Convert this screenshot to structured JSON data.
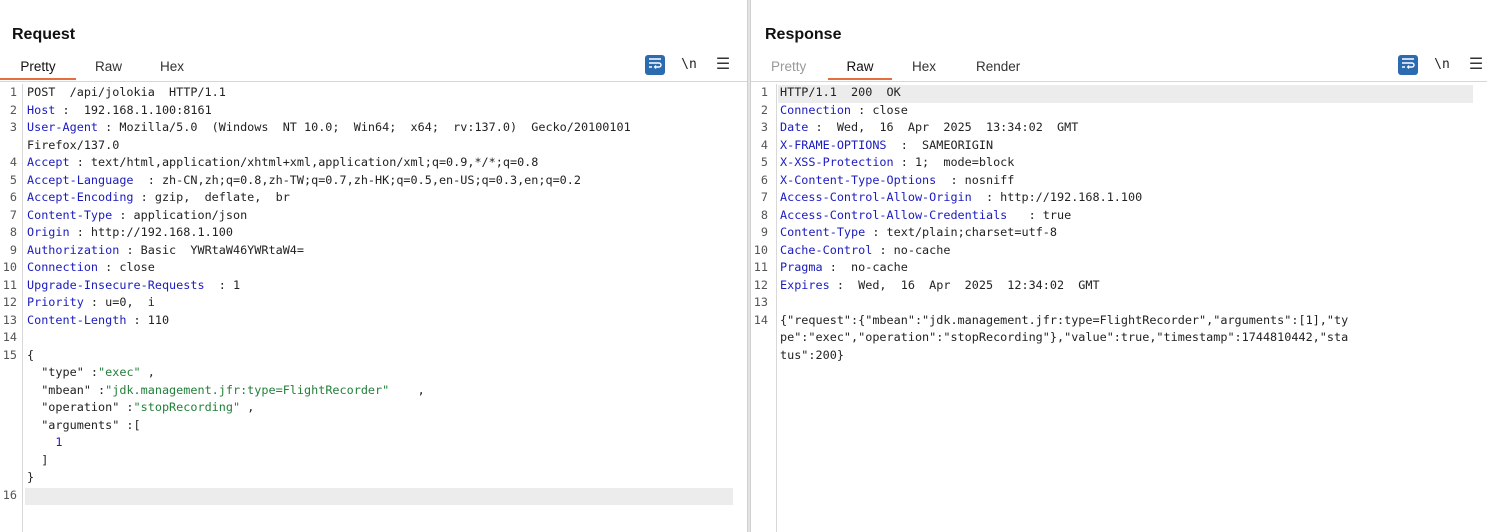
{
  "request": {
    "title": "Request",
    "tabs": [
      "Pretty",
      "Raw",
      "Hex"
    ],
    "active_tab": "Pretty",
    "lines": [
      {
        "n": "1",
        "parts": [
          [
            "",
            "POST  /api/jolokia  HTTP/1.1"
          ]
        ]
      },
      {
        "n": "2",
        "parts": [
          [
            "hdr",
            "Host"
          ],
          [
            "",
            " :  192.168.1.100:8161"
          ]
        ]
      },
      {
        "n": "3",
        "parts": [
          [
            "hdr",
            "User-Agent"
          ],
          [
            "",
            " : Mozilla/5.0  (Windows  NT 10.0;  Win64;  x64;  rv:137.0)  Gecko/20100101"
          ]
        ]
      },
      {
        "n": "",
        "parts": [
          [
            "",
            "Firefox/137.0"
          ]
        ]
      },
      {
        "n": "4",
        "parts": [
          [
            "hdr",
            "Accept"
          ],
          [
            "",
            " : text/html,application/xhtml+xml,application/xml;q=0.9,*/*;q=0.8"
          ]
        ]
      },
      {
        "n": "5",
        "parts": [
          [
            "hdr",
            "Accept-Language"
          ],
          [
            "",
            "  : zh-CN,zh;q=0.8,zh-TW;q=0.7,zh-HK;q=0.5,en-US;q=0.3,en;q=0.2"
          ]
        ]
      },
      {
        "n": "6",
        "parts": [
          [
            "hdr",
            "Accept-Encoding"
          ],
          [
            "",
            " : gzip,  deflate,  br"
          ]
        ]
      },
      {
        "n": "7",
        "parts": [
          [
            "hdr",
            "Content-Type"
          ],
          [
            "",
            " : application/json"
          ]
        ]
      },
      {
        "n": "8",
        "parts": [
          [
            "hdr",
            "Origin"
          ],
          [
            "",
            " : http://192.168.1.100"
          ]
        ]
      },
      {
        "n": "9",
        "parts": [
          [
            "hdr",
            "Authorization"
          ],
          [
            "",
            " : Basic  YWRtaW46YWRtaW4="
          ]
        ]
      },
      {
        "n": "10",
        "parts": [
          [
            "hdr",
            "Connection"
          ],
          [
            "",
            " : close"
          ]
        ]
      },
      {
        "n": "11",
        "parts": [
          [
            "hdr",
            "Upgrade-Insecure-Requests"
          ],
          [
            "",
            "  : 1"
          ]
        ]
      },
      {
        "n": "12",
        "parts": [
          [
            "hdr",
            "Priority"
          ],
          [
            "",
            " : u=0,  i"
          ]
        ]
      },
      {
        "n": "13",
        "parts": [
          [
            "hdr",
            "Content-Length"
          ],
          [
            "",
            " : 110"
          ]
        ]
      },
      {
        "n": "14",
        "parts": []
      },
      {
        "n": "15",
        "parts": [
          [
            "",
            "{"
          ]
        ]
      },
      {
        "n": "",
        "parts": [
          [
            "",
            "  \"type\" :"
          ],
          [
            "str",
            "\"exec\""
          ],
          [
            "",
            " ,"
          ]
        ]
      },
      {
        "n": "",
        "parts": [
          [
            "",
            "  \"mbean\" :"
          ],
          [
            "str",
            "\"jdk.management.jfr:type=FlightRecorder\""
          ],
          [
            "",
            "    ,"
          ]
        ]
      },
      {
        "n": "",
        "parts": [
          [
            "",
            "  \"operation\" :"
          ],
          [
            "str",
            "\"stopRecording\""
          ],
          [
            "",
            " ,"
          ]
        ]
      },
      {
        "n": "",
        "parts": [
          [
            "",
            "  \"arguments\" :["
          ]
        ]
      },
      {
        "n": "",
        "parts": [
          [
            "",
            "    "
          ],
          [
            "num",
            "1"
          ]
        ]
      },
      {
        "n": "",
        "parts": [
          [
            "",
            "  ]"
          ]
        ]
      },
      {
        "n": "",
        "parts": [
          [
            "",
            "}"
          ]
        ]
      },
      {
        "n": "16",
        "parts": [],
        "highlight": true
      }
    ]
  },
  "response": {
    "title": "Response",
    "tabs": [
      "Pretty",
      "Raw",
      "Hex",
      "Render"
    ],
    "active_tab": "Raw",
    "disabled_tab": "Pretty",
    "lines": [
      {
        "n": "1",
        "parts": [
          [
            "",
            "HTTP/1.1  200  OK"
          ]
        ],
        "highlight": true
      },
      {
        "n": "2",
        "parts": [
          [
            "hdr",
            "Connection"
          ],
          [
            "",
            " : close"
          ]
        ]
      },
      {
        "n": "3",
        "parts": [
          [
            "hdr",
            "Date"
          ],
          [
            "",
            " :  Wed,  16  Apr  2025  13:34:02  GMT"
          ]
        ]
      },
      {
        "n": "4",
        "parts": [
          [
            "hdr",
            "X-FRAME-OPTIONS"
          ],
          [
            "",
            "  :  SAMEORIGIN"
          ]
        ]
      },
      {
        "n": "5",
        "parts": [
          [
            "hdr",
            "X-XSS-Protection"
          ],
          [
            "",
            " : 1;  mode=block"
          ]
        ]
      },
      {
        "n": "6",
        "parts": [
          [
            "hdr",
            "X-Content-Type-Options"
          ],
          [
            "",
            "  : nosniff"
          ]
        ]
      },
      {
        "n": "7",
        "parts": [
          [
            "hdr",
            "Access-Control-Allow-Origin"
          ],
          [
            "",
            "  : http://192.168.1.100"
          ]
        ]
      },
      {
        "n": "8",
        "parts": [
          [
            "hdr",
            "Access-Control-Allow-Credentials"
          ],
          [
            "",
            "   : true"
          ]
        ]
      },
      {
        "n": "9",
        "parts": [
          [
            "hdr",
            "Content-Type"
          ],
          [
            "",
            " : text/plain;charset=utf-8"
          ]
        ]
      },
      {
        "n": "10",
        "parts": [
          [
            "hdr",
            "Cache-Control"
          ],
          [
            "",
            " : no-cache"
          ]
        ]
      },
      {
        "n": "11",
        "parts": [
          [
            "hdr",
            "Pragma"
          ],
          [
            "",
            " :  no-cache"
          ]
        ]
      },
      {
        "n": "12",
        "parts": [
          [
            "hdr",
            "Expires"
          ],
          [
            "",
            " :  Wed,  16  Apr  2025  12:34:02  GMT"
          ]
        ]
      },
      {
        "n": "13",
        "parts": []
      },
      {
        "n": "14",
        "parts": [
          [
            "",
            "{\"request\":{\"mbean\":\"jdk.management.jfr:type=FlightRecorder\",\"arguments\":[1],\"ty"
          ]
        ]
      },
      {
        "n": "",
        "parts": [
          [
            "",
            "pe\":\"exec\",\"operation\":\"stopRecording\"},\"value\":true,\"timestamp\":1744810442,\"sta"
          ]
        ]
      },
      {
        "n": "",
        "parts": [
          [
            "",
            "tus\":200}"
          ]
        ]
      }
    ]
  },
  "toolbar": {
    "wrap_icon": "wrap-lines-icon",
    "newline_label": "\\n",
    "menu_icon": "menu-icon"
  },
  "layout_buttons": [
    "split-horizontal-icon",
    "split-vertical-icon",
    "single-pane-icon"
  ],
  "colors": {
    "accent": "#e56e3c",
    "blue": "#2b6cb0",
    "header_name": "#1b1bbf",
    "json_string": "#23803a"
  }
}
